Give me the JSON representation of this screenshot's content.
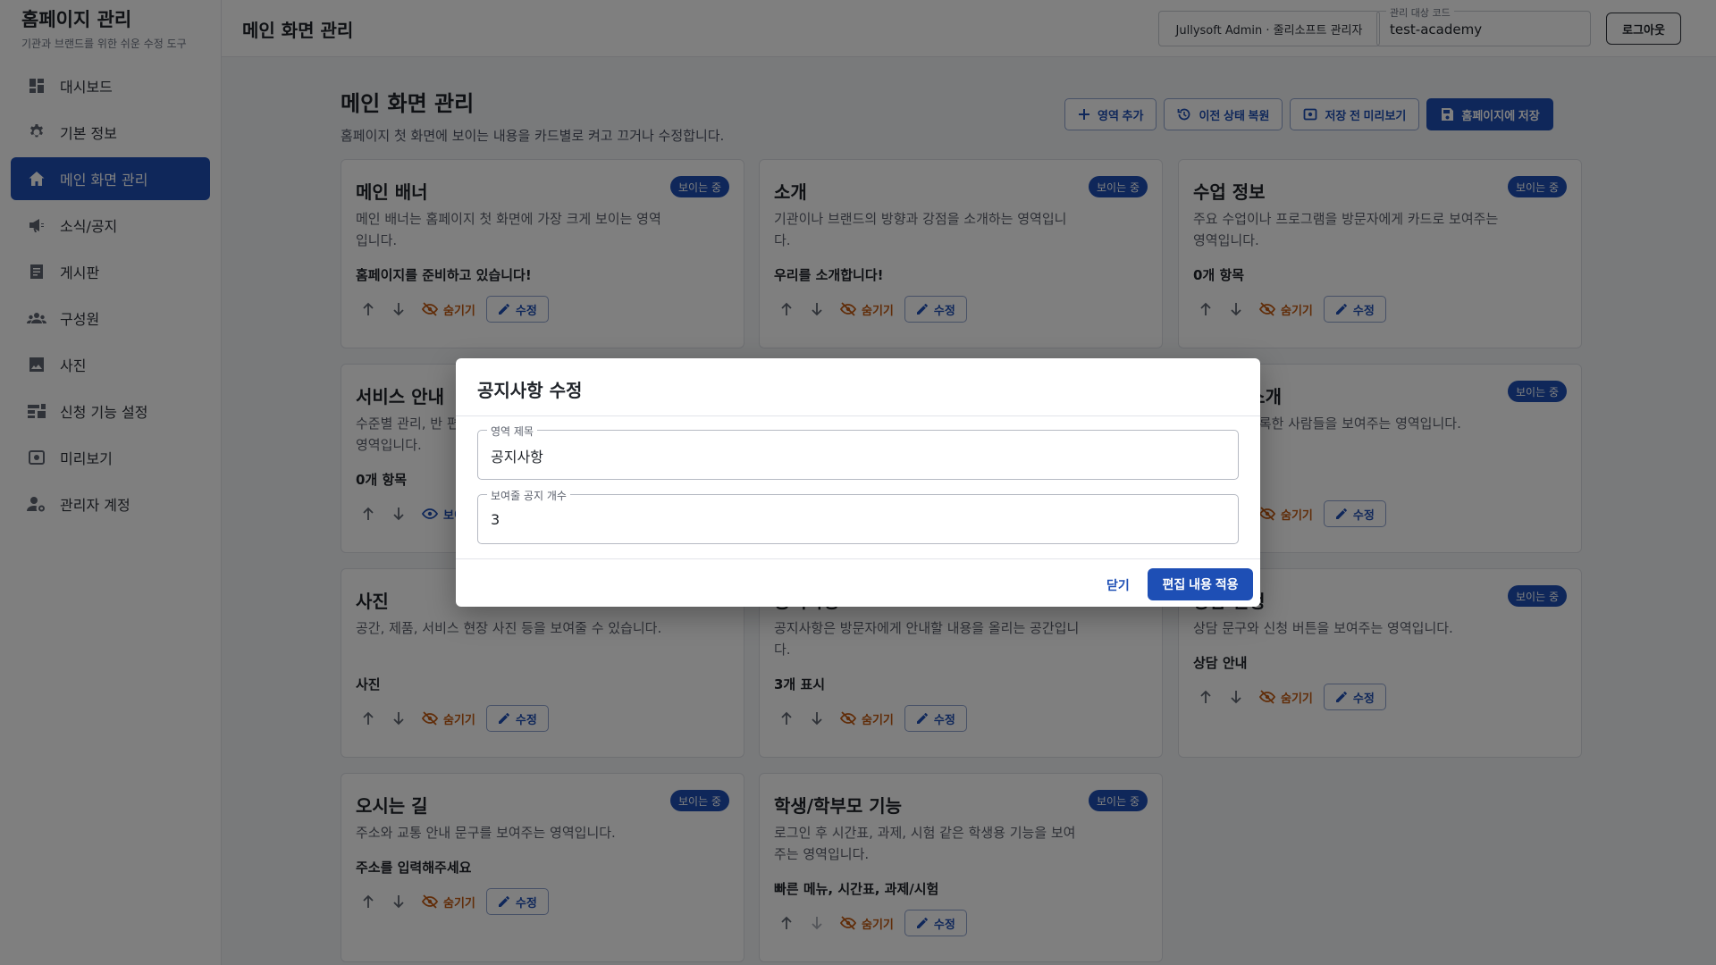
{
  "brand": {
    "title": "홈페이지 관리",
    "subtitle": "기관과 브랜드를 위한 쉬운 수정 도구"
  },
  "sidebar": {
    "items": [
      {
        "label": "대시보드",
        "icon": "dashboard-icon",
        "active": false
      },
      {
        "label": "기본 정보",
        "icon": "gear-icon",
        "active": false
      },
      {
        "label": "메인 화면 관리",
        "icon": "home-icon",
        "active": true
      },
      {
        "label": "소식/공지",
        "icon": "megaphone-icon",
        "active": false
      },
      {
        "label": "게시판",
        "icon": "board-icon",
        "active": false
      },
      {
        "label": "구성원",
        "icon": "people-icon",
        "active": false
      },
      {
        "label": "사진",
        "icon": "image-icon",
        "active": false
      },
      {
        "label": "신청 기능 설정",
        "icon": "form-settings-icon",
        "active": false
      },
      {
        "label": "미리보기",
        "icon": "preview-icon",
        "active": false
      },
      {
        "label": "관리자 계정",
        "icon": "admin-account-icon",
        "active": false
      }
    ]
  },
  "topbar": {
    "title": "메인 화면 관리",
    "admin_chip": "Jullysoft Admin · 줄리소프트 관리자",
    "code_label": "관리 대상 코드",
    "code_value": "test-academy",
    "logout": "로그아웃"
  },
  "page": {
    "title": "메인 화면 관리",
    "description": "홈페이지 첫 화면에 보이는 내용을 카드별로 켜고 끄거나 수정합니다.",
    "actions": {
      "add": "영역 추가",
      "restore": "이전 상태 복원",
      "preview": "저장 전 미리보기",
      "save": "홈페이지에 저장"
    }
  },
  "card_labels": {
    "badge": "보이는 중",
    "hide": "숨기기",
    "show": "보이기",
    "edit": "수정"
  },
  "cards": [
    {
      "title": "메인 배너",
      "desc": "메인 배너는 홈페이지 첫 화면에 가장 크게 보이는 영역입니다.",
      "summary": "홈페이지를 준비하고 있습니다!"
    },
    {
      "title": "소개",
      "desc": "기관이나 브랜드의 방향과 강점을 소개하는 영역입니다.",
      "summary": "우리를 소개합니다!"
    },
    {
      "title": "수업 정보",
      "desc": "주요 수업이나 프로그램을 방문자에게 카드로 보여주는 영역입니다.",
      "summary": "0개 항목"
    },
    {
      "title": "서비스 안내",
      "desc": "수준별 관리, 반 편성 등 서비스를 리스트로 보여주는 영역입니다.",
      "summary": "0개 항목"
    },
    {
      "title": "구성원 소개",
      "desc": "구성원에 등록한 사람들을 보여주는 영역입니다.",
      "summary": ""
    },
    {
      "title": "사진",
      "desc": "공간, 제품, 서비스 현장 사진 등을 보여줄 수 있습니다.",
      "summary": "사진"
    },
    {
      "title": "공지사항",
      "desc": "공지사항은 방문자에게 안내할 내용을 올리는 공간입니다.",
      "summary": "3개 표시"
    },
    {
      "title": "상담 신청",
      "desc": "상담 문구와 신청 버튼을 보여주는 영역입니다.",
      "summary": "상담 안내"
    },
    {
      "title": "오시는 길",
      "desc": "주소와 교통 안내 문구를 보여주는 영역입니다.",
      "summary": "주소를 입력해주세요"
    },
    {
      "title": "학생/학부모 기능",
      "desc": "로그인 후 시간표, 과제, 시험 같은 학생용 기능을 보여주는 영역입니다.",
      "summary": "빠른 메뉴, 시간표, 과제/시험"
    }
  ],
  "modal": {
    "title": "공지사항 수정",
    "field1": {
      "label": "영역 제목",
      "value": "공지사항"
    },
    "field2": {
      "label": "보여줄 공지 개수",
      "value": "3"
    },
    "close": "닫기",
    "apply": "편집 내용 적용"
  }
}
